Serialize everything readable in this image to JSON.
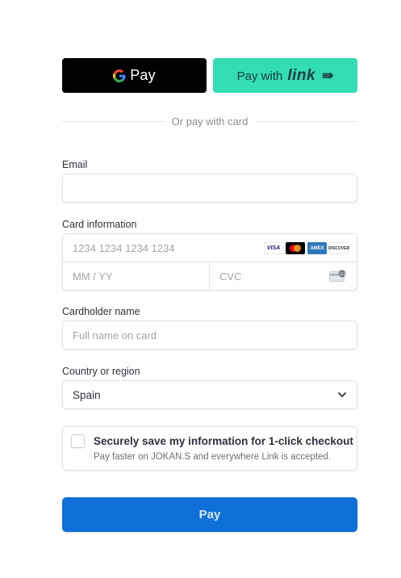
{
  "express": {
    "gpay_label": "Pay",
    "link_prefix": "Pay with",
    "link_word": "link",
    "link_arrow": "⇛"
  },
  "divider_text": "Or pay with card",
  "email": {
    "label": "Email",
    "value": "",
    "placeholder": ""
  },
  "card": {
    "label": "Card information",
    "number_placeholder": "1234 1234 1234 1234",
    "expiry_placeholder": "MM / YY",
    "cvc_placeholder": "CVC",
    "brands": [
      "VISA",
      "Mastercard",
      "AMEX",
      "DISCOVER"
    ]
  },
  "cardholder": {
    "label": "Cardholder name",
    "placeholder": "Full name on card"
  },
  "country": {
    "label": "Country or region",
    "selected": "Spain"
  },
  "save": {
    "title": "Securely save my information for 1-click checkout",
    "subtitle": "Pay faster on JOKAN.S and everywhere Link is accepted.",
    "checked": false
  },
  "pay_button_label": "Pay",
  "colors": {
    "gpay_bg": "#000000",
    "link_bg": "#33ddb3",
    "pay_bg": "#0f71d8"
  },
  "icons": [
    "google-g-icon",
    "link-arrow-icon",
    "visa-icon",
    "mastercard-icon",
    "amex-icon",
    "discover-icon",
    "cvc-card-icon",
    "chevron-down-icon"
  ]
}
